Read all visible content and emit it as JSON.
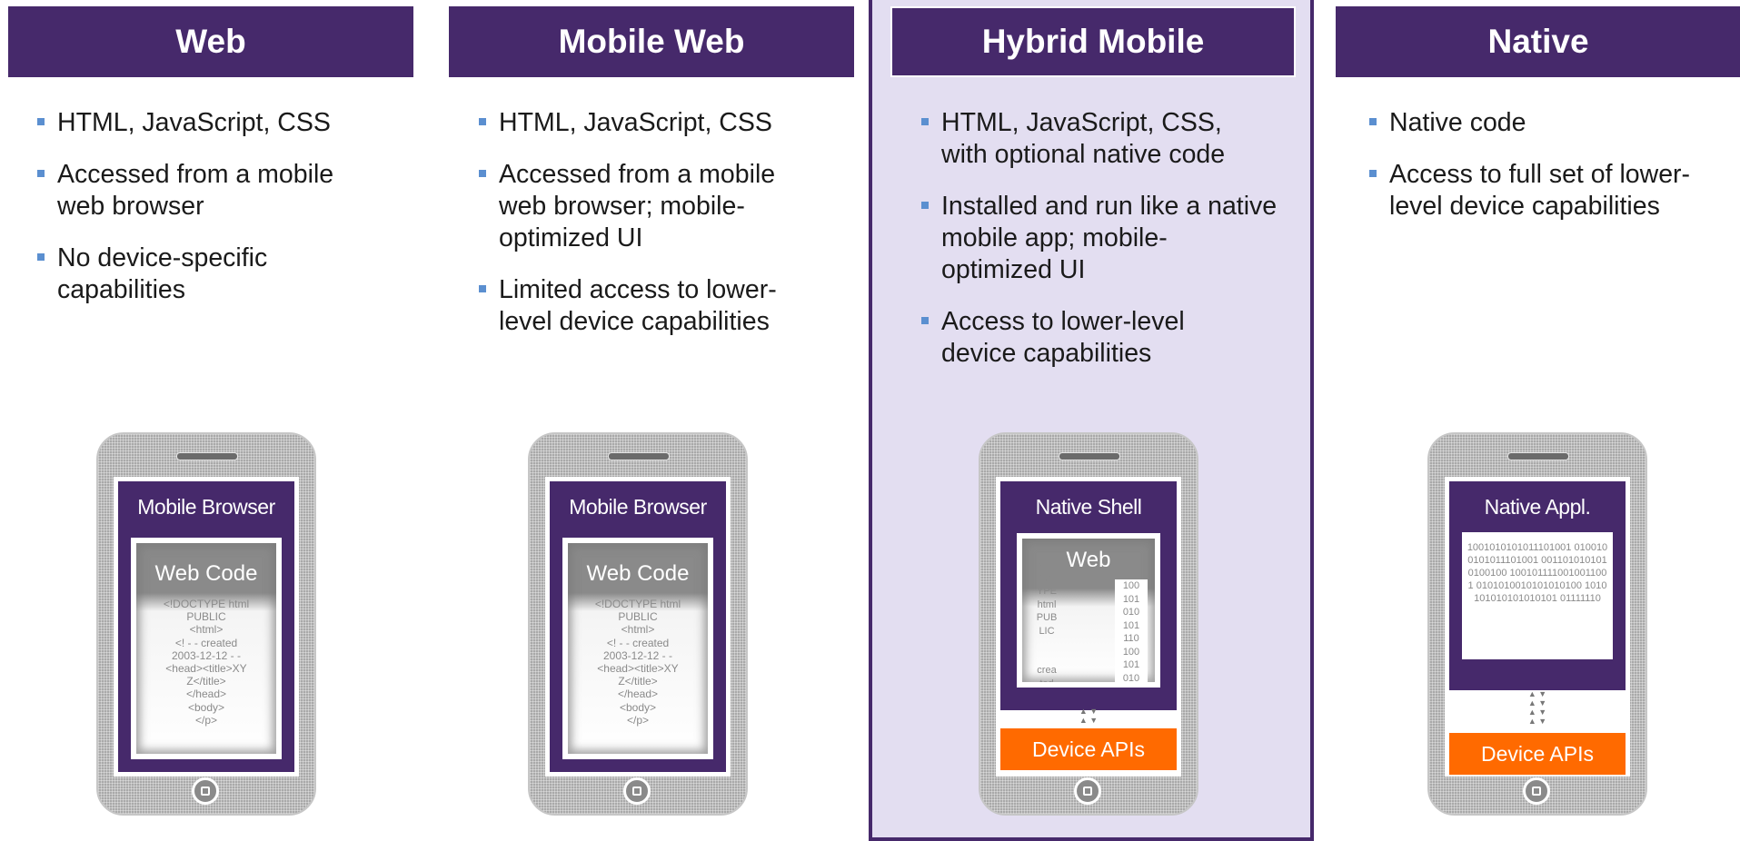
{
  "columns": [
    {
      "title": "Web",
      "bullets": [
        "HTML, JavaScript, CSS",
        "Accessed from a mobile web browser",
        "No device-specific capabilities"
      ],
      "phone": {
        "app_label": "Mobile Browser",
        "code_title": "Web Code",
        "code_text": "<!DOCTYPE html\nPUBLIC\n<html>\n<! - - created\n2003-12-12 - -\n<head><title>XY\nZ</title>\n</head>\n<body>\n</p>"
      }
    },
    {
      "title": "Mobile Web",
      "bullets": [
        "HTML, JavaScript, CSS",
        "Accessed from a mobile web browser; mobile-optimized UI",
        "Limited access to lower-level device capabilities"
      ],
      "phone": {
        "app_label": "Mobile Browser",
        "code_title": "Web Code",
        "code_text": "<!DOCTYPE html\nPUBLIC\n<html>\n<! - - created\n2003-12-12 - -\n<head><title>XY\nZ</title>\n</head>\n<body>\n</p>"
      }
    },
    {
      "title": "Hybrid Mobile",
      "bullets": [
        "HTML, JavaScript, CSS, with optional native code",
        "Installed and run like a native mobile app; mobile-optimized UI",
        "Access to lower-level device capabilities"
      ],
      "phone": {
        "app_label": "Native Shell",
        "code_title": "Web",
        "code_left": "<!D\nOCT\nYPE\nhtml\nPUB\nLIC\n\n\ncrea\nted",
        "code_right": "100\n101\n010\n101\n110\n100\n101\n010",
        "apis_label": "Device APIs"
      }
    },
    {
      "title": "Native",
      "bullets": [
        "Native code",
        "Access to full set of lower-level device capabilities"
      ],
      "phone": {
        "app_label": "Native Appl.",
        "binary": "1001010101011101001 0100100101011101001 0011010101010100100 1001011110010011001 0101010010101010100 1010101010101010101 01111110",
        "apis_label": "Device APIs"
      }
    }
  ]
}
